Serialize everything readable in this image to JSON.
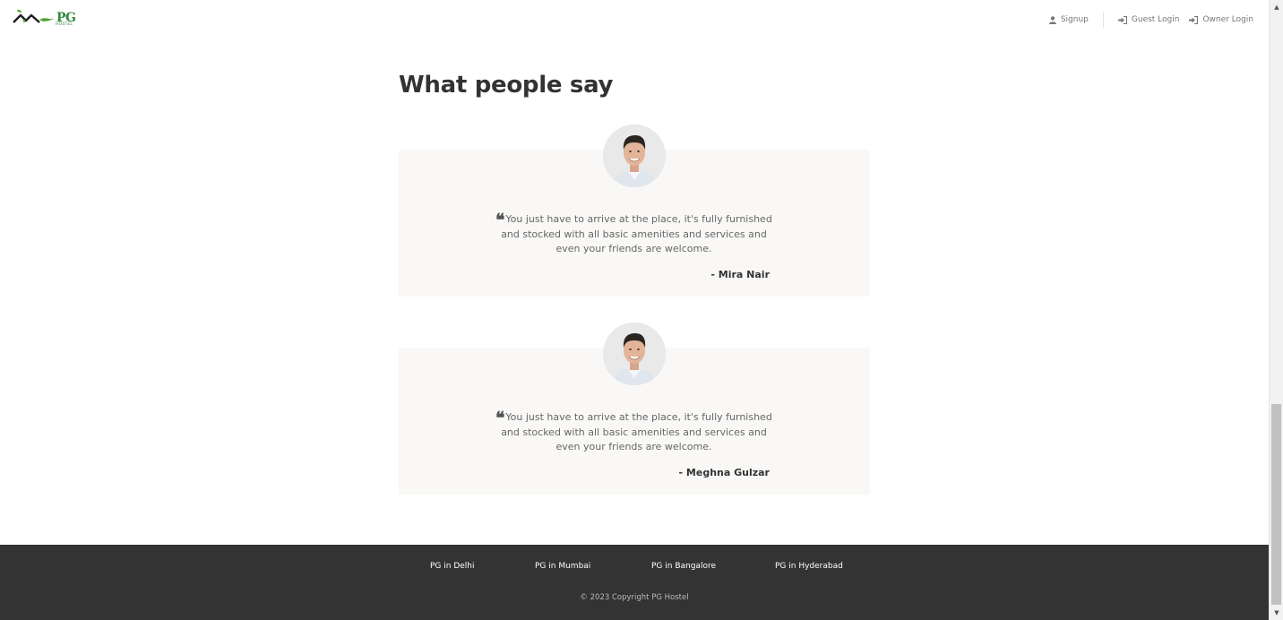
{
  "header": {
    "logo_text": "PG",
    "logo_sub": "HOSTEL",
    "nav": {
      "signup": "Signup",
      "guest_login": "Guest Login",
      "owner_login": "Owner Login"
    }
  },
  "testimonials": {
    "title": "What people say",
    "items": [
      {
        "quote": "You just have to arrive at the place, it's fully furnished and stocked with all basic amenities and services and even your friends are welcome.",
        "author": "- Mira Nair"
      },
      {
        "quote": "You just have to arrive at the place, it's fully furnished and stocked with all basic amenities and services and even your friends are welcome.",
        "author": "- Meghna Gulzar"
      }
    ]
  },
  "footer": {
    "links": [
      "PG in Delhi",
      "PG in Mumbai",
      "PG in Bangalore",
      "PG in Hyderabad"
    ],
    "copyright": "© 2023 Copyright PG Hostel"
  },
  "colors": {
    "brand": "#2f8a3b",
    "footer_bg": "#333333",
    "card_bg": "#f9f8f6"
  }
}
